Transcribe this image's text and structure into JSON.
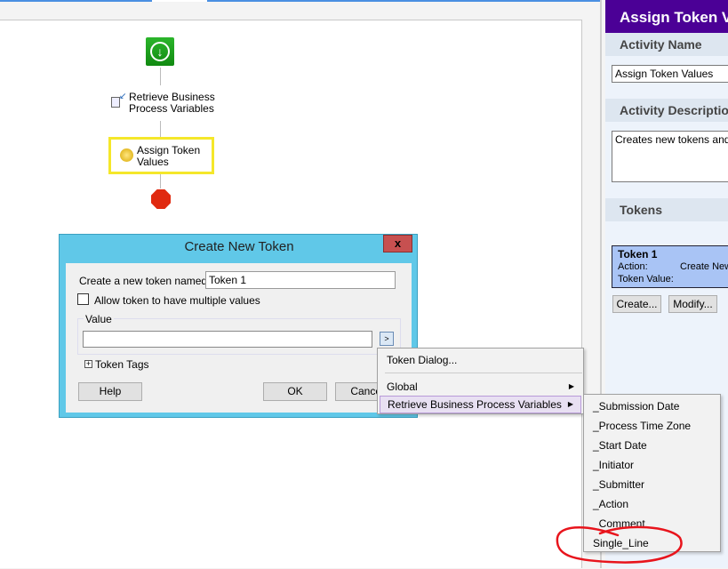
{
  "workflow": {
    "nodes": [
      {
        "label": "Retrieve Business Process Variables",
        "line1": "Retrieve Business",
        "line2": "Process Variables"
      },
      {
        "label": "Assign Token Values",
        "line1": "Assign Token",
        "line2": "Values"
      }
    ]
  },
  "panel": {
    "title": "Assign Token Values",
    "activity_name_label": "Activity Name",
    "activity_name_value": "Assign Token Values",
    "activity_description_label": "Activity Description",
    "activity_description_value": "Creates new tokens and updates existing tokens",
    "tokens_label": "Tokens",
    "token": {
      "name": "Token 1",
      "action_label": "Action:",
      "action_value": "Create New",
      "value_label": "Token Value:"
    },
    "create_button": "Create...",
    "modify_button": "Modify..."
  },
  "dialog": {
    "title": "Create New Token",
    "close": "x",
    "name_label": "Create a new token named:",
    "name_value": "Token 1",
    "multiple_label": "Allow token to have multiple values",
    "multiple_checked": false,
    "value_group": "Value",
    "value_input": "",
    "value_button": ">",
    "tags_label": "Token Tags",
    "help": "Help",
    "ok": "OK",
    "cancel": "Cancel"
  },
  "context_menu": {
    "items": [
      "Token Dialog...",
      "Global",
      "Retrieve Business Process Variables"
    ],
    "submenu": [
      "_Submission Date",
      "_Process Time Zone",
      "_Start Date",
      "_Initiator",
      "_Submitter",
      "_Action",
      "_Comment",
      "Single_Line"
    ]
  },
  "colors": {
    "panel_header": "#4b0096",
    "dialog_frame": "#60c8e8",
    "highlight": "#f5e72a",
    "annotation": "#e8141c"
  }
}
